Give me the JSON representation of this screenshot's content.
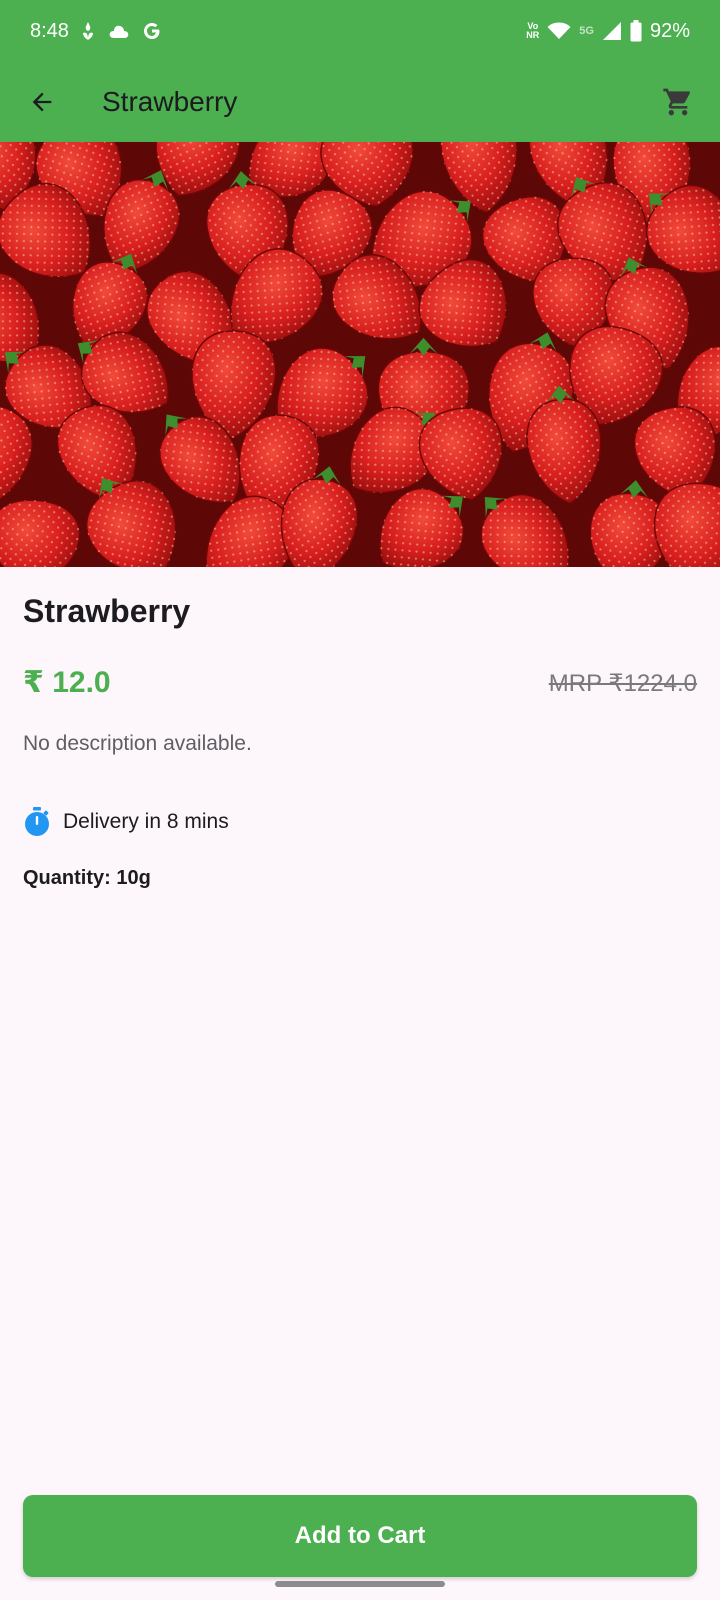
{
  "status_bar": {
    "time": "8:48",
    "volte_top": "Vo",
    "volte_bottom": "NR",
    "network": "5G",
    "battery": "92%"
  },
  "app_bar": {
    "title": "Strawberry",
    "back_icon": "arrow-back-icon",
    "cart_icon": "shopping-cart-icon"
  },
  "hero_image": {
    "subject": "strawberries"
  },
  "product": {
    "name": "Strawberry",
    "price": "₹ 12.0",
    "mrp": "MRP ₹1224.0",
    "description": "No description available.",
    "delivery": "Delivery in 8 mins",
    "quantity": "Quantity: 10g"
  },
  "actions": {
    "add_to_cart": "Add to Cart"
  },
  "colors": {
    "primary": "#4CAF50",
    "background": "#FDF7FC",
    "timer_icon": "#2196F3",
    "strawberry_red": "#D81E1E"
  }
}
